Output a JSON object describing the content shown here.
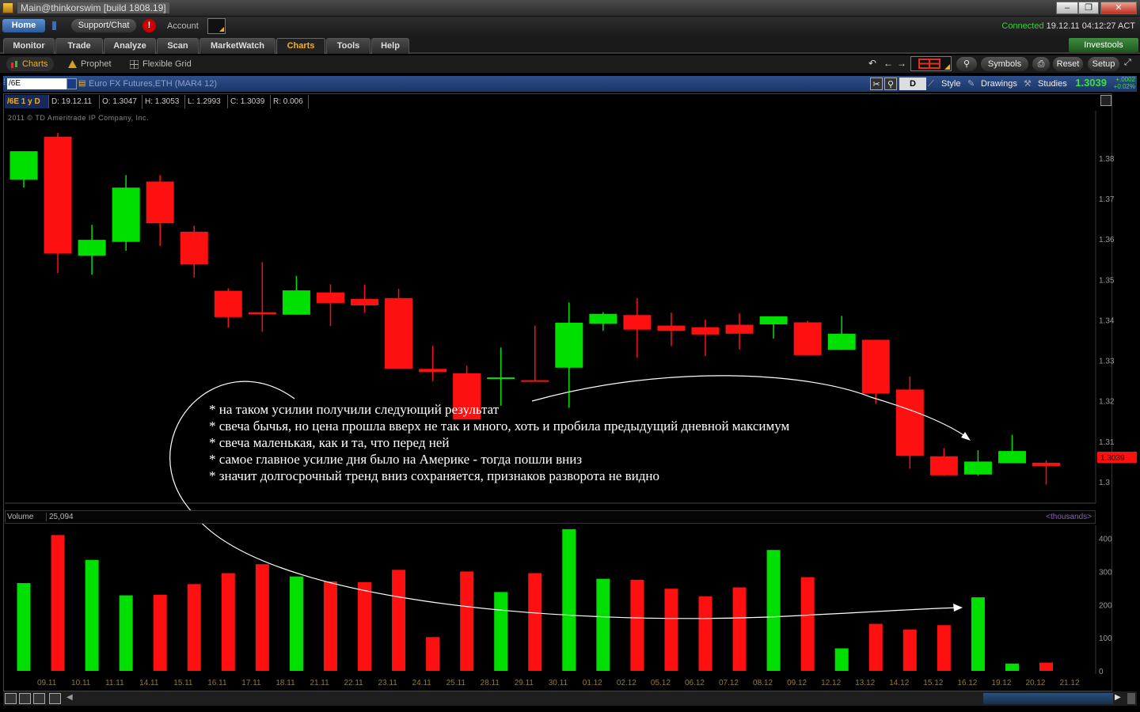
{
  "window": {
    "title": "Main@thinkorswim [build 1808.19]",
    "buttons": [
      "–",
      "❐",
      "✕"
    ]
  },
  "topbar": {
    "home": "Home",
    "support": "Support/Chat",
    "alert": "!",
    "account_label": "Account",
    "status_connected": "Connected",
    "status_time": "19.12.11 04:12:27 ACT"
  },
  "tabs": [
    "Monitor",
    "Trade",
    "Analyze",
    "Scan",
    "MarketWatch",
    "Charts",
    "Tools",
    "Help"
  ],
  "active_tab": "Charts",
  "investools": "Investools",
  "subtabs": {
    "charts": "Charts",
    "prophet": "Prophet",
    "flexible_grid": "Flexible Grid"
  },
  "toolbar_right": {
    "symbols": "Symbols",
    "reset": "Reset",
    "setup": "Setup"
  },
  "chart_header": {
    "symbol": "/6E",
    "description": "Euro FX Futures,ETH (MAR4 12)",
    "aggregation": "D",
    "style": "Style",
    "drawings": "Drawings",
    "studies": "Studies",
    "price": "1.3039",
    "change_abs": "+.0002",
    "change_pct": "+0.02%"
  },
  "infobar": {
    "name": "/6E 1 y D",
    "d": "D: 19.12.11",
    "o": "O: 1.3047",
    "h": "H: 1.3053",
    "l": "L: 1.2993",
    "c": "C: 1.3039",
    "r": "R: 0.006"
  },
  "copyright": "2011 © TD Ameritrade IP Company, Inc.",
  "last_price_tag": "1.3039",
  "volume_header": {
    "label": "Volume",
    "value": "25,094",
    "units": "<thousands>"
  },
  "annotation": [
    "* на таком усилии получили следующий результат",
    "* свеча бычья, но цена прошла вверх не так и много, хоть и пробила предыдущий дневной максимум",
    "* свеча маленькая, как и та, что перед ней",
    "* самое главное усилие дня было на Америке - тогда пошли вниз",
    "* значит долгосрочный тренд вниз сохраняется, признаков разворота не видно"
  ],
  "colors": {
    "up": "#00e000",
    "down": "#ff1010",
    "price_axis": "#999999",
    "date_axis": "#9a7a20"
  },
  "chart_data": {
    "type": "candlestick",
    "price_axis_ticks": [
      "1.38",
      "1.37",
      "1.36",
      "1.35",
      "1.34",
      "1.33",
      "1.32",
      "1.31",
      "1.3"
    ],
    "price_ylim": [
      1.2955,
      1.3917
    ],
    "volume_axis_ticks": [
      "400",
      "300",
      "200",
      "100",
      "0"
    ],
    "volume_ylim": [
      0,
      430
    ],
    "date_labels": [
      "09.11",
      "10.11",
      "11.11",
      "14.11",
      "15.11",
      "16.11",
      "17.11",
      "18.11",
      "21.11",
      "22.11",
      "23.11",
      "24.11",
      "25.11",
      "28.11",
      "29.11",
      "30.11",
      "01.12",
      "02.12",
      "05.12",
      "06.12",
      "07.12",
      "08.12",
      "09.12",
      "12.12",
      "13.12",
      "14.12",
      "15.12",
      "16.12",
      "19.12",
      "20.12",
      "21.12"
    ],
    "candles": [
      {
        "o": 1.3747,
        "h": 1.3785,
        "l": 1.3727,
        "c": 1.3817,
        "v": 265
      },
      {
        "o": 1.3853,
        "h": 1.3862,
        "l": 1.3516,
        "c": 1.3564,
        "v": 410
      },
      {
        "o": 1.3559,
        "h": 1.3635,
        "l": 1.3512,
        "c": 1.3598,
        "v": 335
      },
      {
        "o": 1.3593,
        "h": 1.3758,
        "l": 1.3571,
        "c": 1.3727,
        "v": 228
      },
      {
        "o": 1.3742,
        "h": 1.3758,
        "l": 1.3583,
        "c": 1.3639,
        "v": 230
      },
      {
        "o": 1.3618,
        "h": 1.3633,
        "l": 1.3505,
        "c": 1.3537,
        "v": 262
      },
      {
        "o": 1.3472,
        "h": 1.3478,
        "l": 1.3381,
        "c": 1.3407,
        "v": 295
      },
      {
        "o": 1.3419,
        "h": 1.3543,
        "l": 1.3371,
        "c": 1.3414,
        "v": 322
      },
      {
        "o": 1.3413,
        "h": 1.3509,
        "l": 1.3428,
        "c": 1.3473,
        "v": 285
      },
      {
        "o": 1.3468,
        "h": 1.3488,
        "l": 1.3385,
        "c": 1.3442,
        "v": 270
      },
      {
        "o": 1.3452,
        "h": 1.3487,
        "l": 1.3418,
        "c": 1.3436,
        "v": 268
      },
      {
        "o": 1.3454,
        "h": 1.3477,
        "l": 1.3295,
        "c": 1.3279,
        "v": 305
      },
      {
        "o": 1.3279,
        "h": 1.3336,
        "l": 1.3249,
        "c": 1.3271,
        "v": 102
      },
      {
        "o": 1.3268,
        "h": 1.3287,
        "l": 1.3187,
        "c": 1.3154,
        "v": 300
      },
      {
        "o": 1.3254,
        "h": 1.3332,
        "l": 1.3188,
        "c": 1.3258,
        "v": 238
      },
      {
        "o": 1.3251,
        "h": 1.3386,
        "l": 1.3267,
        "c": 1.3249,
        "v": 295
      },
      {
        "o": 1.3282,
        "h": 1.3443,
        "l": 1.3183,
        "c": 1.3393,
        "v": 428
      },
      {
        "o": 1.3391,
        "h": 1.3419,
        "l": 1.3373,
        "c": 1.3415,
        "v": 278
      },
      {
        "o": 1.3412,
        "h": 1.3454,
        "l": 1.3307,
        "c": 1.3376,
        "v": 275
      },
      {
        "o": 1.3386,
        "h": 1.3418,
        "l": 1.3335,
        "c": 1.3373,
        "v": 248
      },
      {
        "o": 1.3382,
        "h": 1.3401,
        "l": 1.3311,
        "c": 1.3364,
        "v": 225
      },
      {
        "o": 1.3388,
        "h": 1.3416,
        "l": 1.3327,
        "c": 1.3366,
        "v": 252
      },
      {
        "o": 1.3389,
        "h": 1.3407,
        "l": 1.3354,
        "c": 1.3409,
        "v": 365
      },
      {
        "o": 1.3394,
        "h": 1.3398,
        "l": 1.3322,
        "c": 1.3313,
        "v": 283
      },
      {
        "o": 1.3326,
        "h": 1.341,
        "l": 1.3351,
        "c": 1.3366,
        "v": 68
      },
      {
        "o": 1.3351,
        "h": 1.335,
        "l": 1.3193,
        "c": 1.3218,
        "v": 142
      },
      {
        "o": 1.3228,
        "h": 1.326,
        "l": 1.3032,
        "c": 1.3064,
        "v": 125
      },
      {
        "o": 1.3063,
        "h": 1.3083,
        "l": 1.3015,
        "c": 1.3016,
        "v": 138
      },
      {
        "o": 1.3018,
        "h": 1.3078,
        "l": 1.3015,
        "c": 1.305,
        "v": 222
      },
      {
        "o": 1.3046,
        "h": 1.3116,
        "l": 1.3049,
        "c": 1.3076,
        "v": 22
      },
      {
        "o": 1.3047,
        "h": 1.3053,
        "l": 1.2993,
        "c": 1.3039,
        "v": 25
      }
    ]
  }
}
